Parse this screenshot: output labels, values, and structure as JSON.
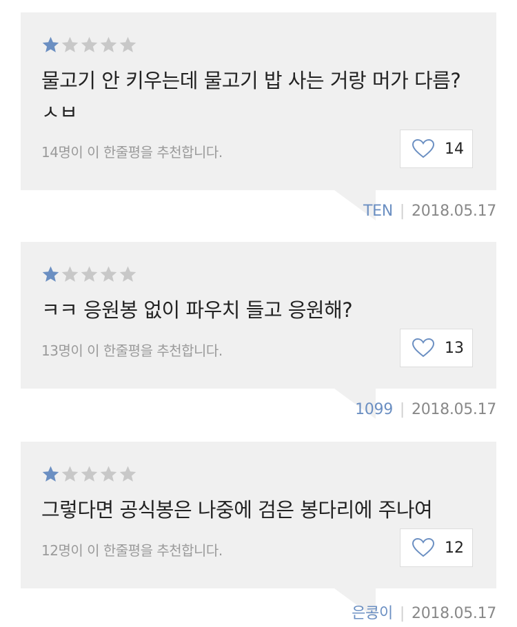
{
  "colors": {
    "star_filled": "#6b8fc2",
    "star_empty": "#c8c8c8",
    "heart_outline": "#6b8fc2",
    "card_bg": "#f0f0f0",
    "author_text": "#6b8fc2"
  },
  "icons": {
    "star": "star-icon",
    "heart": "heart-icon"
  },
  "reviews": [
    {
      "rating": 1,
      "max_rating": 5,
      "text": "물고기 안 키우는데 물고기 밥 사는 거랑 머가 다름? ㅅㅂ",
      "recommend_text": "14명이 이 한줄평을 추천합니다.",
      "likes": "14",
      "author": "TEN",
      "separator": "|",
      "date": "2018.05.17"
    },
    {
      "rating": 1,
      "max_rating": 5,
      "text": "ㅋㅋ 응원봉 없이 파우치 들고 응원해?",
      "recommend_text": "13명이 이 한줄평을 추천합니다.",
      "likes": "13",
      "author": "1099",
      "separator": "|",
      "date": "2018.05.17"
    },
    {
      "rating": 1,
      "max_rating": 5,
      "text": "그렇다면 공식봉은 나중에 검은 봉다리에 주나여",
      "recommend_text": "12명이 이 한줄평을 추천합니다.",
      "likes": "12",
      "author": "은콩이",
      "separator": "|",
      "date": "2018.05.17"
    }
  ]
}
